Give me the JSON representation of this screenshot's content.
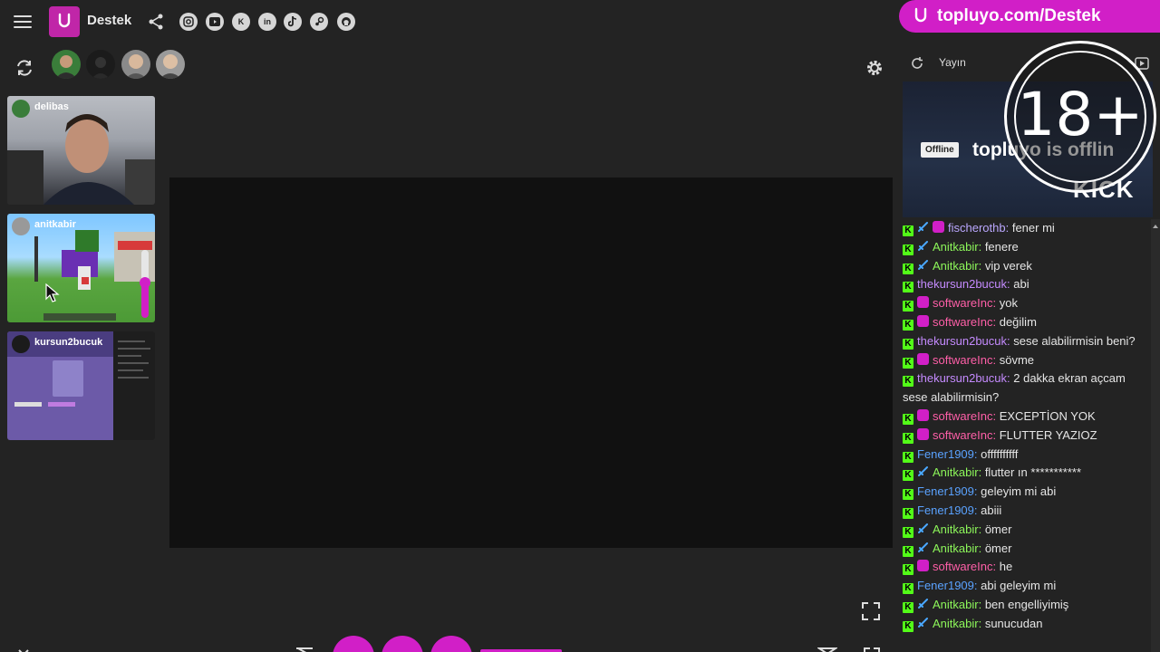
{
  "header": {
    "brand": "Destek"
  },
  "banner": {
    "text": "topluyo.com/Destek"
  },
  "chat_header": {
    "label": "Yayın"
  },
  "cams": [
    {
      "name": "delibas"
    },
    {
      "name": "anitkabir"
    },
    {
      "name": "kursun2bucuk"
    }
  ],
  "preview": {
    "badge": "Offline",
    "text": "topluyo is offlin",
    "watermark": "KICK",
    "age_badge": "18+"
  },
  "chat": {
    "messages": [
      {
        "user": "fischerothb",
        "color": "#bba8ff",
        "badges": [
          "k",
          "sword",
          "p"
        ],
        "text": "fener mi"
      },
      {
        "user": "Anitkabir",
        "color": "#8df75a",
        "badges": [
          "k",
          "sword"
        ],
        "text": "fenere"
      },
      {
        "user": "Anitkabir",
        "color": "#8df75a",
        "badges": [
          "k",
          "sword"
        ],
        "text": "vip verek"
      },
      {
        "user": "thekursun2bucuk",
        "color": "#c58bff",
        "badges": [
          "k"
        ],
        "text": "abi"
      },
      {
        "user": "softwareInc",
        "color": "#ff5fa8",
        "badges": [
          "k",
          "p"
        ],
        "text": "yok"
      },
      {
        "user": "softwareInc",
        "color": "#ff5fa8",
        "badges": [
          "k",
          "p"
        ],
        "text": "değilim"
      },
      {
        "user": "thekursun2bucuk",
        "color": "#c58bff",
        "badges": [
          "k"
        ],
        "text": "sese alabilirmisin beni?"
      },
      {
        "user": "softwareInc",
        "color": "#ff5fa8",
        "badges": [
          "k",
          "p"
        ],
        "text": "sövme"
      },
      {
        "user": "thekursun2bucuk",
        "color": "#c58bff",
        "badges": [
          "k"
        ],
        "text": "2 dakka ekran açcam sese alabilirmisin?"
      },
      {
        "user": "softwareInc",
        "color": "#ff5fa8",
        "badges": [
          "k",
          "p"
        ],
        "text": "EXCEPTİON YOK"
      },
      {
        "user": "softwareInc",
        "color": "#ff5fa8",
        "badges": [
          "k",
          "p"
        ],
        "text": "FLUTTER YAZIOZ"
      },
      {
        "user": "Fener1909",
        "color": "#5aa2ff",
        "badges": [
          "k"
        ],
        "text": "offffffffff"
      },
      {
        "user": "Anitkabir",
        "color": "#8df75a",
        "badges": [
          "k",
          "sword"
        ],
        "text": "flutter ın ***********"
      },
      {
        "user": "Fener1909",
        "color": "#5aa2ff",
        "badges": [
          "k"
        ],
        "text": "geleyim mi abi"
      },
      {
        "user": "Fener1909",
        "color": "#5aa2ff",
        "badges": [
          "k"
        ],
        "text": "abiii"
      },
      {
        "user": "Anitkabir",
        "color": "#8df75a",
        "badges": [
          "k",
          "sword"
        ],
        "text": "ömer"
      },
      {
        "user": "Anitkabir",
        "color": "#8df75a",
        "badges": [
          "k",
          "sword"
        ],
        "text": "ömer"
      },
      {
        "user": "softwareInc",
        "color": "#ff5fa8",
        "badges": [
          "k",
          "p"
        ],
        "text": "he"
      },
      {
        "user": "Fener1909",
        "color": "#5aa2ff",
        "badges": [
          "k"
        ],
        "text": "abi geleyim mi"
      },
      {
        "user": "Anitkabir",
        "color": "#8df75a",
        "badges": [
          "k",
          "sword"
        ],
        "text": "ben engelliyimiş"
      },
      {
        "user": "Anitkabir",
        "color": "#8df75a",
        "badges": [
          "k",
          "sword"
        ],
        "text": "sunucudan"
      }
    ]
  },
  "colors": {
    "accent": "#d11fc7",
    "kick_green": "#53fc18",
    "background": "#232323"
  }
}
